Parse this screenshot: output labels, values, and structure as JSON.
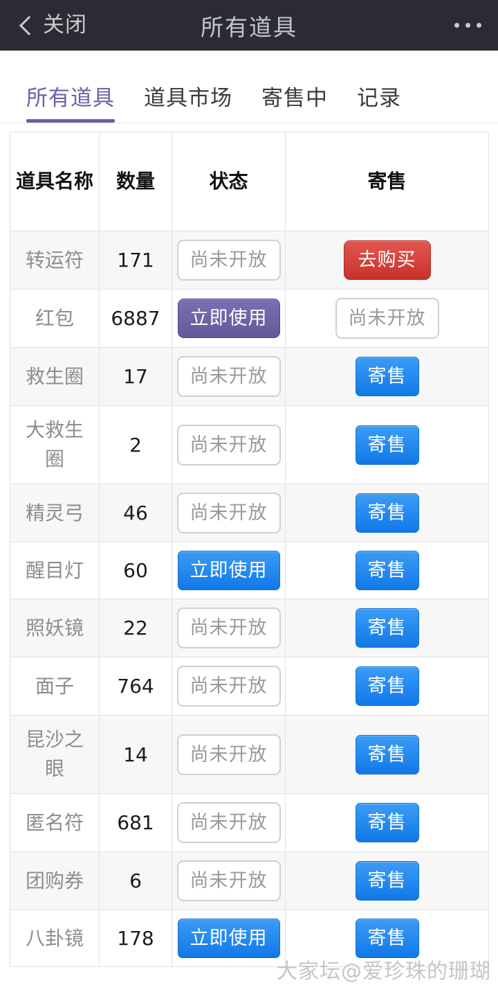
{
  "navbar": {
    "close_label": "关闭",
    "title": "所有道具",
    "back_icon": "chevron-left-icon",
    "more_icon": "more-horizontal-icon"
  },
  "tabs": [
    {
      "label": "所有道具",
      "active": true
    },
    {
      "label": "道具市场",
      "active": false
    },
    {
      "label": "寄售中",
      "active": false
    },
    {
      "label": "记录",
      "active": false
    }
  ],
  "table": {
    "headers": [
      "道具名称",
      "数量",
      "状态",
      "寄售"
    ],
    "rows": [
      {
        "name": "转运符",
        "qty": "171",
        "status": {
          "label": "尚未开放",
          "style": "disabled"
        },
        "sell": {
          "label": "去购买",
          "style": "red"
        }
      },
      {
        "name": "红包",
        "qty": "6887",
        "status": {
          "label": "立即使用",
          "style": "purple"
        },
        "sell": {
          "label": "尚未开放",
          "style": "disabled"
        }
      },
      {
        "name": "救生圈",
        "qty": "17",
        "status": {
          "label": "尚未开放",
          "style": "disabled"
        },
        "sell": {
          "label": "寄售",
          "style": "blue"
        }
      },
      {
        "name": "大救生圈",
        "qty": "2",
        "status": {
          "label": "尚未开放",
          "style": "disabled"
        },
        "sell": {
          "label": "寄售",
          "style": "blue"
        }
      },
      {
        "name": "精灵弓",
        "qty": "46",
        "status": {
          "label": "尚未开放",
          "style": "disabled"
        },
        "sell": {
          "label": "寄售",
          "style": "blue"
        }
      },
      {
        "name": "醒目灯",
        "qty": "60",
        "status": {
          "label": "立即使用",
          "style": "blue"
        },
        "sell": {
          "label": "寄售",
          "style": "blue"
        }
      },
      {
        "name": "照妖镜",
        "qty": "22",
        "status": {
          "label": "尚未开放",
          "style": "disabled"
        },
        "sell": {
          "label": "寄售",
          "style": "blue"
        }
      },
      {
        "name": "面子",
        "qty": "764",
        "status": {
          "label": "尚未开放",
          "style": "disabled"
        },
        "sell": {
          "label": "寄售",
          "style": "blue"
        }
      },
      {
        "name": "昆沙之眼",
        "qty": "14",
        "status": {
          "label": "尚未开放",
          "style": "disabled"
        },
        "sell": {
          "label": "寄售",
          "style": "blue"
        }
      },
      {
        "name": "匿名符",
        "qty": "681",
        "status": {
          "label": "尚未开放",
          "style": "disabled"
        },
        "sell": {
          "label": "寄售",
          "style": "blue"
        }
      },
      {
        "name": "团购券",
        "qty": "6",
        "status": {
          "label": "尚未开放",
          "style": "disabled"
        },
        "sell": {
          "label": "寄售",
          "style": "blue"
        }
      },
      {
        "name": "八卦镜",
        "qty": "178",
        "status": {
          "label": "立即使用",
          "style": "blue"
        },
        "sell": {
          "label": "寄售",
          "style": "blue"
        }
      }
    ]
  },
  "watermark": {
    "text": "大家坛@爱珍珠的珊瑚"
  },
  "colors": {
    "navbar_bg": "#2b2c33",
    "accent_purple": "#6a61a6",
    "button_blue": "#1178e8",
    "button_red": "#c7322c",
    "row_alt_bg": "#f7f7f7",
    "border": "#e2e2e2"
  }
}
